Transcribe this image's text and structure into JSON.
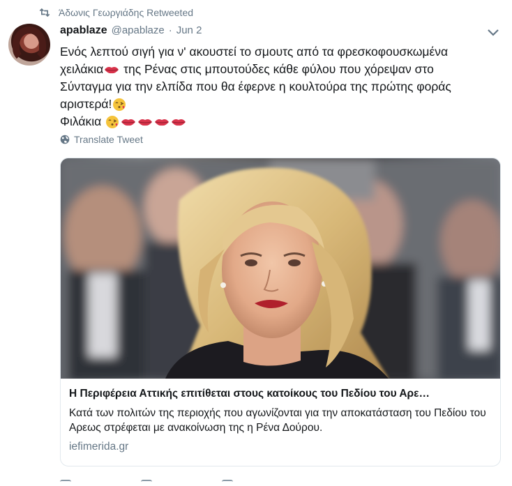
{
  "retweet": {
    "icon": "retweet-icon",
    "text": "Άδωνις Γεωργιάδης Retweeted"
  },
  "tweet": {
    "display_name": "apablaze",
    "handle": "@apablaze",
    "separator": "·",
    "date": "Jun 2",
    "text_lines": [
      "Ενός λεπτού σιγή για ν' ακουστεί το σμουτς από τα φρεσκοφουσκωμένα",
      [
        "χειλάκια",
        " της Ρένας στις μπουτούδες κάθε φύλου που χόρεψαν στο"
      ],
      "Σύνταγμα για την ελπίδα που θα έφερνε η κουλτούρα της πρώτης φοράς",
      "αριστερά!",
      "Φιλάκια"
    ],
    "emojis": {
      "lips": "kiss-mark-lips-emoji",
      "kiss": "face-blowing-kiss-emoji"
    },
    "translate_label": "Translate Tweet"
  },
  "card": {
    "title": "Η Περιφέρεια Αττικής επιτίθεται στους κατοίκους του Πεδίου του Αρε…",
    "description": "Κατά των πολιτών της περιοχής που αγωνίζονται για την αποκατάσταση του Πεδίου του Αρεως στρέφεται με ανακοίνωση της η Ρένα Δούρου.",
    "domain": "iefimerida.gr"
  },
  "colors": {
    "text": "#14171a",
    "muted": "#657786",
    "border": "#e1e8ed",
    "lips": "#d9334b"
  }
}
